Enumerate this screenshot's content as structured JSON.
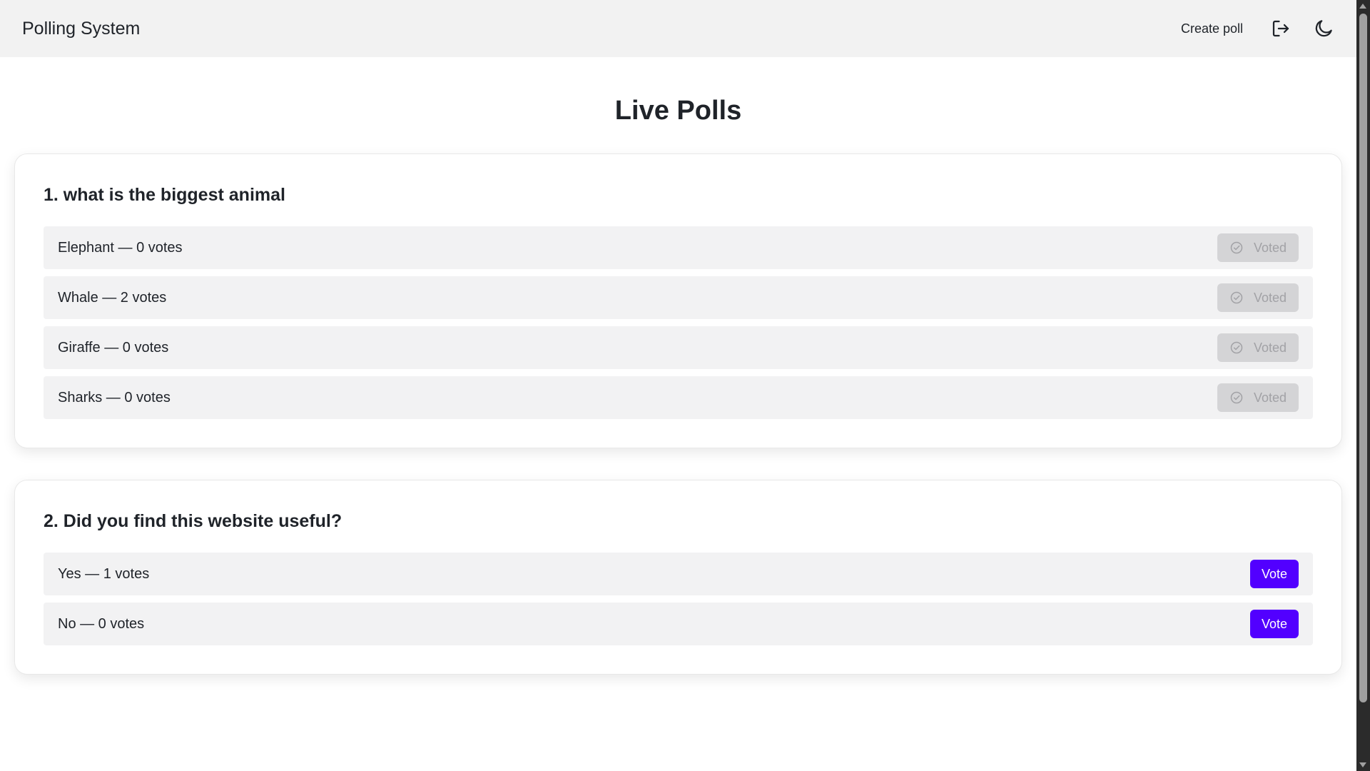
{
  "app": {
    "title": "Polling System"
  },
  "nav": {
    "create_poll_label": "Create poll",
    "logout_icon": "logout-icon",
    "theme_icon": "moon-icon"
  },
  "page": {
    "title": "Live Polls"
  },
  "colors": {
    "accent": "#5200ff",
    "navbar_bg": "#f2f2f2",
    "option_bg": "#f2f2f3",
    "voted_bg": "#d4d4d6"
  },
  "polls": [
    {
      "question": "1. what is the biggest animal",
      "options": [
        {
          "text": "Elephant — 0 votes",
          "button": "Voted"
        },
        {
          "text": "Whale — 2 votes",
          "button": "Voted"
        },
        {
          "text": "Giraffe — 0 votes",
          "button": "Voted"
        },
        {
          "text": "Sharks — 0 votes",
          "button": "Voted"
        }
      ]
    },
    {
      "question": "2. Did you find this website useful?",
      "options": [
        {
          "text": "Yes — 1 votes",
          "button": "Vote"
        },
        {
          "text": "No — 0 votes",
          "button": "Vote"
        }
      ]
    }
  ]
}
